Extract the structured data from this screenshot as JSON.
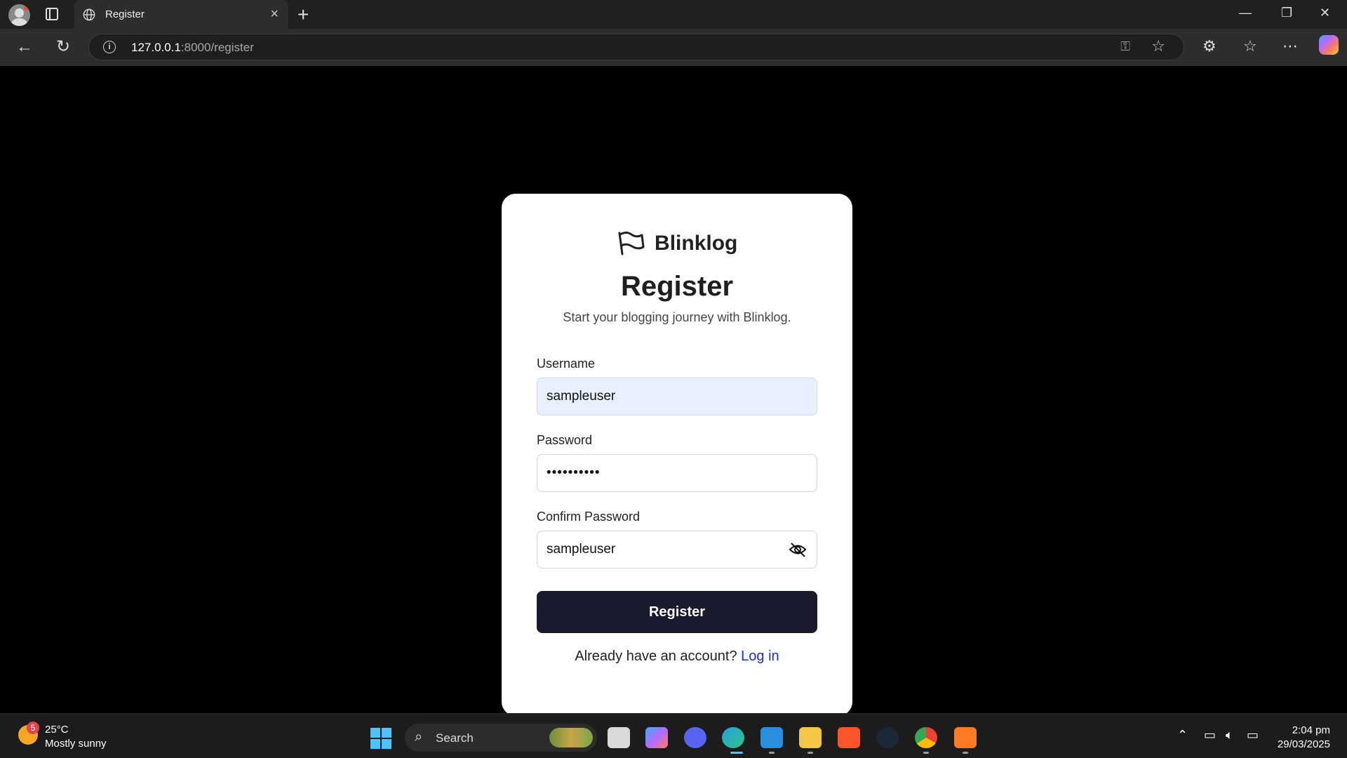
{
  "browser": {
    "tab_title": "Register",
    "url_host": "127.0.0.1",
    "url_path": ":8000/register"
  },
  "page": {
    "brand": "Blinklog",
    "heading": "Register",
    "subheading": "Start your blogging journey with Blinklog.",
    "username_label": "Username",
    "username_value": "sampleuser",
    "password_label": "Password",
    "password_value": "••••••••••",
    "confirm_label": "Confirm Password",
    "confirm_value": "sampleuser",
    "submit_label": "Register",
    "footer_text": "Already have an account?",
    "login_link": "Log in"
  },
  "taskbar": {
    "weather_badge": "5",
    "temperature": "25°C",
    "condition": "Mostly sunny",
    "search_label": "Search",
    "time": "2:04 pm",
    "date": "29/03/2025"
  },
  "colors": {
    "button_bg": "#191a2e",
    "link": "#1a2be0",
    "autofill_bg": "#e8f0fe"
  }
}
